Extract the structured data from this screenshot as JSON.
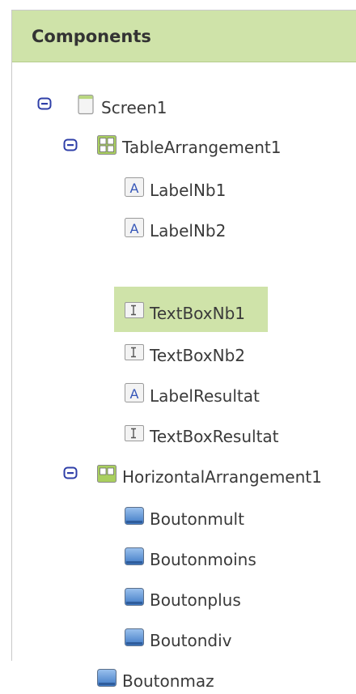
{
  "panel": {
    "title": "Components"
  },
  "tree": {
    "screen": {
      "label": "Screen1"
    },
    "table_arrangement": {
      "label": "TableArrangement1",
      "children": [
        "LabelNb1",
        "LabelNb2",
        "TextBoxNb1",
        "TextBoxNb2",
        "LabelResultat",
        "TextBoxResultat"
      ]
    },
    "horizontal_arrangement": {
      "label": "HorizontalArrangement1",
      "children": [
        "Boutonmult",
        "Boutonmoins",
        "Boutonplus",
        "Boutondiv"
      ]
    },
    "bouton_maz": {
      "label": "Boutonmaz"
    },
    "selected": "TextBoxNb1"
  },
  "colors": {
    "header_bg": "#cfe3a9",
    "selected_bg": "#cfe3a9",
    "toggle_blue": "#2f3fa8",
    "button_icon_blue": "#5b95d6"
  },
  "icons": {
    "screen": "screen-icon",
    "table": "table-arrangement-icon",
    "horizontal": "horizontal-arrangement-icon",
    "label": "label-icon",
    "textbox": "textbox-icon",
    "button": "button-icon",
    "collapse": "collapse-toggle-icon"
  }
}
